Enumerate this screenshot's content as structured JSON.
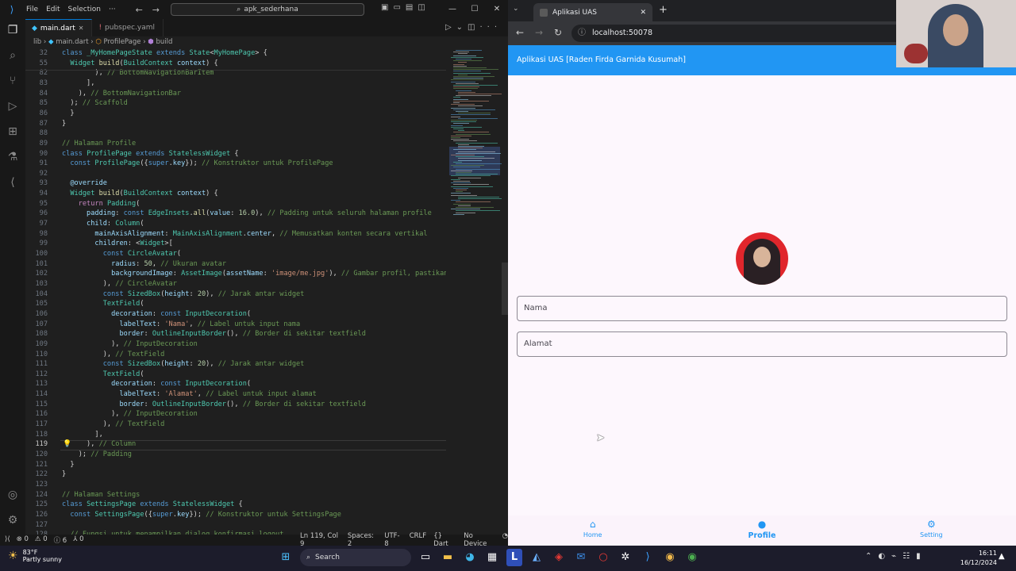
{
  "vscode": {
    "menu": [
      "File",
      "Edit",
      "Selection",
      "···"
    ],
    "command_center": "apk_sederhana",
    "window_controls": {
      "minimize": "—",
      "maximize": "☐",
      "close": "✕"
    },
    "tabs": [
      {
        "label": "main.dart",
        "active": true
      },
      {
        "label": "pubspec.yaml",
        "active": false
      }
    ],
    "breadcrumb": {
      "folder": "lib",
      "file": "main.dart",
      "class": "ProfilePage",
      "method": "build"
    },
    "editor_lines": [
      {
        "n": "32",
        "sticky": true,
        "html": "<span class='k'>class</span> <span class='t'>_MyHomePageState</span> <span class='k'>extends</span> <span class='t'>State</span>&lt;<span class='t'>MyHomePage</span>&gt; {"
      },
      {
        "n": "55",
        "sticky": true,
        "html": "  <span class='t'>Widget</span> <span class='f'>build</span>(<span class='t'>BuildContext</span> <span class='p'>context</span>) {"
      },
      {
        "n": "82",
        "html": "        ), <span class='c'>// BottomNavigationBarItem</span>"
      },
      {
        "n": "83",
        "html": "      ],"
      },
      {
        "n": "84",
        "html": "    ), <span class='c'>// BottomNavigationBar</span>"
      },
      {
        "n": "85",
        "html": "  ); <span class='c'>// Scaffold</span>"
      },
      {
        "n": "86",
        "html": "  }"
      },
      {
        "n": "87",
        "html": "}"
      },
      {
        "n": "88",
        "html": ""
      },
      {
        "n": "89",
        "html": "<span class='c'>// Halaman Profile</span>"
      },
      {
        "n": "90",
        "html": "<span class='k'>class</span> <span class='t'>ProfilePage</span> <span class='k'>extends</span> <span class='t'>StatelessWidget</span> {"
      },
      {
        "n": "91",
        "html": "  <span class='k'>const</span> <span class='t'>ProfilePage</span>({<span class='k'>super</span>.<span class='p'>key</span>}); <span class='c'>// Konstruktor untuk ProfilePage</span>"
      },
      {
        "n": "92",
        "html": ""
      },
      {
        "n": "93",
        "html": "  <span class='p'>@override</span>"
      },
      {
        "n": "94",
        "html": "  <span class='t'>Widget</span> <span class='f'>build</span>(<span class='t'>BuildContext</span> <span class='p'>context</span>) {"
      },
      {
        "n": "95",
        "html": "    <span class='kc'>return</span> <span class='t'>Padding</span>("
      },
      {
        "n": "96",
        "html": "      <span class='p'>padding</span>: <span class='k'>const</span> <span class='t'>EdgeInsets</span>.<span class='f'>all</span>(<span class='p'>value</span>: <span class='n'>16.0</span>), <span class='c'>// Padding untuk seluruh halaman profile</span>"
      },
      {
        "n": "97",
        "html": "      <span class='p'>child</span>: <span class='t'>Column</span>("
      },
      {
        "n": "98",
        "html": "        <span class='p'>mainAxisAlignment</span>: <span class='t'>MainAxisAlignment</span>.<span class='p'>center</span>, <span class='c'>// Memusatkan konten secara vertikal</span>"
      },
      {
        "n": "99",
        "html": "        <span class='p'>children</span>: &lt;<span class='t'>Widget</span>&gt;["
      },
      {
        "n": "100",
        "html": "          <span class='k'>const</span> <span class='t'>CircleAvatar</span>("
      },
      {
        "n": "101",
        "html": "            <span class='p'>radius</span>: <span class='n'>50</span>, <span class='c'>// Ukuran avatar</span>"
      },
      {
        "n": "102",
        "html": "            <span class='p'>backgroundImage</span>: <span class='t'>AssetImage</span>(<span class='p'>assetName</span>: <span class='s'>'image/me.jpg'</span>), <span class='c'>// Gambar profil, pastikan</span>"
      },
      {
        "n": "103",
        "html": "          ), <span class='c'>// CircleAvatar</span>"
      },
      {
        "n": "104",
        "html": "          <span class='k'>const</span> <span class='t'>SizedBox</span>(<span class='p'>height</span>: <span class='n'>20</span>), <span class='c'>// Jarak antar widget</span>"
      },
      {
        "n": "105",
        "html": "          <span class='t'>TextField</span>("
      },
      {
        "n": "106",
        "html": "            <span class='p'>decoration</span>: <span class='k'>const</span> <span class='t'>InputDecoration</span>("
      },
      {
        "n": "107",
        "html": "              <span class='p'>labelText</span>: <span class='s'>'Nama'</span>, <span class='c'>// Label untuk input nama</span>"
      },
      {
        "n": "108",
        "html": "              <span class='p'>border</span>: <span class='t'>OutlineInputBorder</span>(), <span class='c'>// Border di sekitar textfield</span>"
      },
      {
        "n": "109",
        "html": "            ), <span class='c'>// InputDecoration</span>"
      },
      {
        "n": "110",
        "html": "          ), <span class='c'>// TextField</span>"
      },
      {
        "n": "111",
        "html": "          <span class='k'>const</span> <span class='t'>SizedBox</span>(<span class='p'>height</span>: <span class='n'>20</span>), <span class='c'>// Jarak antar widget</span>"
      },
      {
        "n": "112",
        "html": "          <span class='t'>TextField</span>("
      },
      {
        "n": "113",
        "html": "            <span class='p'>decoration</span>: <span class='k'>const</span> <span class='t'>InputDecoration</span>("
      },
      {
        "n": "114",
        "html": "              <span class='p'>labelText</span>: <span class='s'>'Alamat'</span>, <span class='c'>// Label untuk input alamat</span>"
      },
      {
        "n": "115",
        "html": "              <span class='p'>border</span>: <span class='t'>OutlineInputBorder</span>(), <span class='c'>// Border di sekitar textfield</span>"
      },
      {
        "n": "116",
        "html": "            ), <span class='c'>// InputDecoration</span>"
      },
      {
        "n": "117",
        "html": "          ), <span class='c'>// TextField</span>"
      },
      {
        "n": "118",
        "html": "        ],"
      },
      {
        "n": "119",
        "current": true,
        "html": "      ), <span class='c'>// Column</span>"
      },
      {
        "n": "120",
        "html": "    ); <span class='c'>// Padding</span>"
      },
      {
        "n": "121",
        "html": "  }"
      },
      {
        "n": "122",
        "html": "}"
      },
      {
        "n": "123",
        "html": ""
      },
      {
        "n": "124",
        "html": "<span class='c'>// Halaman Settings</span>"
      },
      {
        "n": "125",
        "html": "<span class='k'>class</span> <span class='t'>SettingsPage</span> <span class='k'>extends</span> <span class='t'>StatelessWidget</span> {"
      },
      {
        "n": "126",
        "html": "  <span class='k'>const</span> <span class='t'>SettingsPage</span>({<span class='k'>super</span>.<span class='p'>key</span>}); <span class='c'>// Konstruktor untuk SettingsPage</span>"
      },
      {
        "n": "127",
        "html": ""
      },
      {
        "n": "128",
        "html": "  <span class='c'>// Fungsi untuk menampilkan dialog konfirmasi logout</span>"
      }
    ],
    "status": {
      "errors": "⊗ 0",
      "warnings": "⚠ 0",
      "info": "ⓘ 6",
      "ports": "⅄ 0",
      "position": "Ln 119, Col 9",
      "spaces": "Spaces: 2",
      "encoding": "UTF-8",
      "eol": "CRLF",
      "language": "{} Dart",
      "device": "No Device"
    }
  },
  "browser": {
    "tab_title": "Aplikasi UAS",
    "url": "localhost:50078",
    "app": {
      "appbar_title": "Aplikasi UAS [Raden Firda Garnida Kusumah]",
      "fields": [
        {
          "label": "Nama"
        },
        {
          "label": "Alamat"
        }
      ],
      "nav": [
        {
          "label": "Home",
          "icon": "home-icon",
          "selected": false
        },
        {
          "label": "Profile",
          "icon": "person-icon",
          "selected": true
        },
        {
          "label": "Setting",
          "icon": "gear-icon",
          "selected": false
        }
      ],
      "accent": "#2196f3"
    }
  },
  "taskbar": {
    "weather_temp": "83°F",
    "weather_desc": "Partly sunny",
    "search_placeholder": "Search",
    "time": "16:11",
    "date": "16/12/2024"
  }
}
